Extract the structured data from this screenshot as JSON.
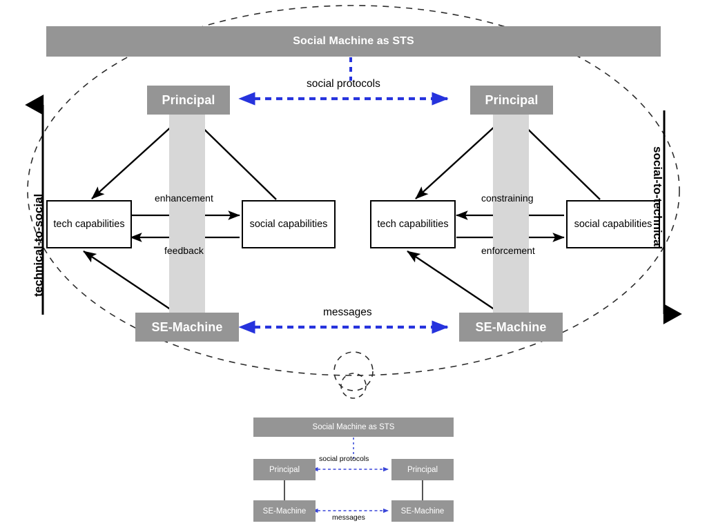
{
  "figure": {
    "title": "Social Machine as STS",
    "accent_blue": "#2633dd",
    "block_grey": "#959595",
    "band_grey": "#d7d7d7",
    "boundary_style": "dashed-ellipse"
  },
  "main": {
    "top_bar_label": "Social Machine as STS",
    "axis_left_label": "technical-to-social",
    "axis_right_label": "social-to-technical",
    "cross_links": [
      {
        "name": "social-protocols",
        "label": "social protocols"
      },
      {
        "name": "messages",
        "label": "messages"
      }
    ],
    "left_column": {
      "principal": "Principal",
      "se_machine": "SE-Machine",
      "tech_capabilities": "tech capabilities",
      "social_capabilities": "social capabilities",
      "relation_top": "enhancement",
      "relation_bottom": "feedback"
    },
    "right_column": {
      "principal": "Principal",
      "se_machine": "SE-Machine",
      "tech_capabilities": "tech capabilities",
      "social_capabilities": "social capabilities",
      "relation_top": "constraining",
      "relation_bottom": "enforcement"
    }
  },
  "thumbnail": {
    "top_bar_label": "Social Machine as STS",
    "left_principal": "Principal",
    "right_principal": "Principal",
    "left_se_machine": "SE-Machine",
    "right_se_machine": "SE-Machine",
    "social_protocols": "social protocols",
    "messages": "messages"
  }
}
